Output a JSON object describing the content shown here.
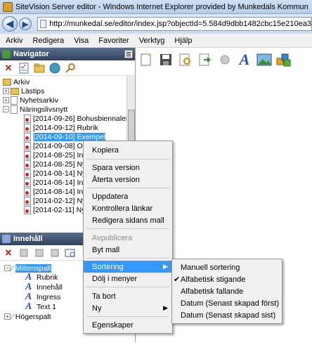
{
  "window": {
    "title": "SiteVision Server editor - Windows Internet Explorer provided by Munkedals Kommun"
  },
  "address": {
    "url": "http://munkedal.se/editor/index.jsp?objectId=5.584d9dbb1482cbc15e210ea3"
  },
  "menubar": [
    "Arkiv",
    "Redigera",
    "Visa",
    "Favoriter",
    "Verktyg",
    "Hjälp"
  ],
  "navigator": {
    "title": "Navigator",
    "tree": [
      {
        "label": "Arkiv"
      },
      {
        "label": "Lästips"
      },
      {
        "label": "Nyhetsarkiv"
      },
      {
        "label": "Näringslivsnytt"
      },
      {
        "label": "[2014-09-26] Bohusbiennalen"
      },
      {
        "label": "[2014-09-12] Rubrik"
      },
      {
        "label": "[2014-09-10] Exempel"
      },
      {
        "label": "[2014-09-08] Or"
      },
      {
        "label": "[2014-08-25] Inl"
      },
      {
        "label": "[2014-08-25] Ny"
      },
      {
        "label": "[2014-08-14] Ny"
      },
      {
        "label": "[2014-08-14] Inl"
      },
      {
        "label": "[2014-08-14] Inl"
      },
      {
        "label": "[2014-02-12] Ny"
      },
      {
        "label": "[2014-02-11] Ny"
      }
    ]
  },
  "content": {
    "title": "Innehåll",
    "tree": [
      {
        "label": "Mittenspalt"
      },
      {
        "label": "Rubrik"
      },
      {
        "label": "Innehåll"
      },
      {
        "label": "Ingress"
      },
      {
        "label": "Text 1"
      },
      {
        "label": "Högerspalt"
      }
    ]
  },
  "context_menu": {
    "items": [
      "Kopiera",
      "Spara version",
      "Återta version",
      "Uppdatera",
      "Kontrollera länkar",
      "Redigera sidans mall",
      "Avpublicera",
      "Byt mall",
      "Sortering",
      "Dölj i menyer",
      "Ta bort",
      "Ny",
      "Egenskaper"
    ]
  },
  "submenu": {
    "items": [
      "Manuell sortering",
      "Alfabetisk stigande",
      "Alfabetisk fallande",
      "Datum (Senast skapad först)",
      "Datum (Senast skapad sist)"
    ],
    "checked": "Alfabetisk stigande"
  },
  "colors": {
    "selection": "#3399ff",
    "pane_header": "#2f4260"
  },
  "icons": [
    "back-arrow-icon",
    "forward-arrow-icon",
    "delete-icon",
    "checklist-icon",
    "folder-icon",
    "globe-icon",
    "search-icon",
    "new-page-icon",
    "save-icon",
    "preview-icon",
    "export-icon",
    "text-A-icon",
    "image-icon",
    "modules-icon"
  ]
}
